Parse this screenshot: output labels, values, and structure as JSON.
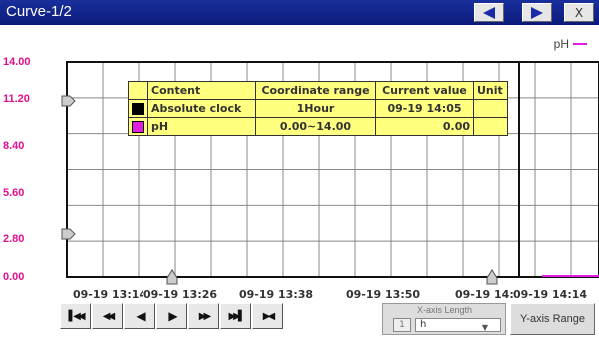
{
  "window": {
    "title": "Curve-1/2",
    "close_label": "X"
  },
  "legend": {
    "series_name": "pH",
    "series_color": "#e020e0"
  },
  "y_axis": {
    "ticks": [
      "14.00",
      "11.20",
      "8.40",
      "5.60",
      "2.80",
      "0.00"
    ],
    "label_color": "#e0108c"
  },
  "x_axis": {
    "ticks": [
      "09-19 13:14",
      "09-19 13:26",
      "09-19 13:38",
      "09-19 13:50",
      "09-19 14:02",
      "09-19 14:14"
    ]
  },
  "info_table": {
    "headers": [
      "Content",
      "Coordinate range",
      "Current value",
      "Unit"
    ],
    "rows": [
      {
        "name": "Absolute clock",
        "range": "1Hour",
        "value": "09-19 14:05",
        "unit": "",
        "color": "#000000"
      },
      {
        "name": "pH",
        "range": "0.00~14.00",
        "value": "0.00",
        "unit": "",
        "color": "#e020e0"
      }
    ]
  },
  "nav_buttons": [
    "first-page",
    "prev-page",
    "prev",
    "play",
    "next",
    "next-page",
    "last-page"
  ],
  "x_axis_length": {
    "label": "X-axis Length",
    "number": "1",
    "unit": "h"
  },
  "y_axis_range_label": "Y-axis Range",
  "colors": {
    "titlebar": "#0b1a7a",
    "table_bg": "#ffff80",
    "accent": "#1a2aa8"
  },
  "chart_data": {
    "type": "line",
    "x": [
      "09-19 14:02",
      "09-19 14:14"
    ],
    "series": [
      {
        "name": "pH",
        "values": [
          0.0,
          0.0
        ]
      }
    ],
    "ylim": [
      0,
      14
    ],
    "grid": true
  }
}
